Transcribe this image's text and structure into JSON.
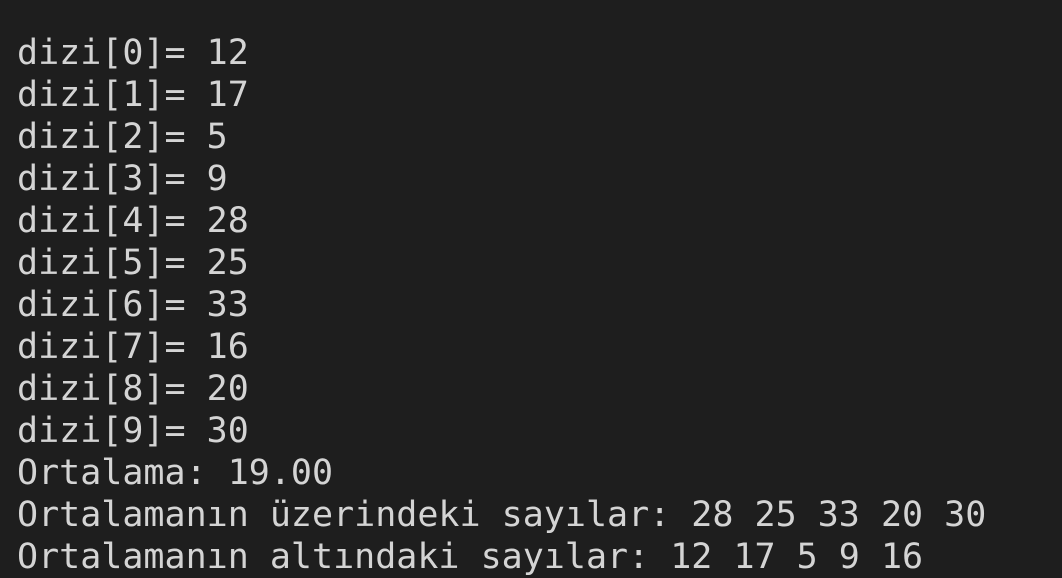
{
  "terminal": {
    "lines": [
      "dizi[0]= 12",
      "dizi[1]= 17",
      "dizi[2]= 5",
      "dizi[3]= 9",
      "dizi[4]= 28",
      "dizi[5]= 25",
      "dizi[6]= 33",
      "dizi[7]= 16",
      "dizi[8]= 20",
      "dizi[9]= 30",
      "Ortalama: 19.00",
      "Ortalamanın üzerindeki sayılar: 28 25 33 20 30",
      "Ortalamanın altındaki sayılar: 12 17 5 9 16"
    ]
  },
  "colors": {
    "background": "#1e1e1e",
    "text": "#d4d4d4"
  }
}
